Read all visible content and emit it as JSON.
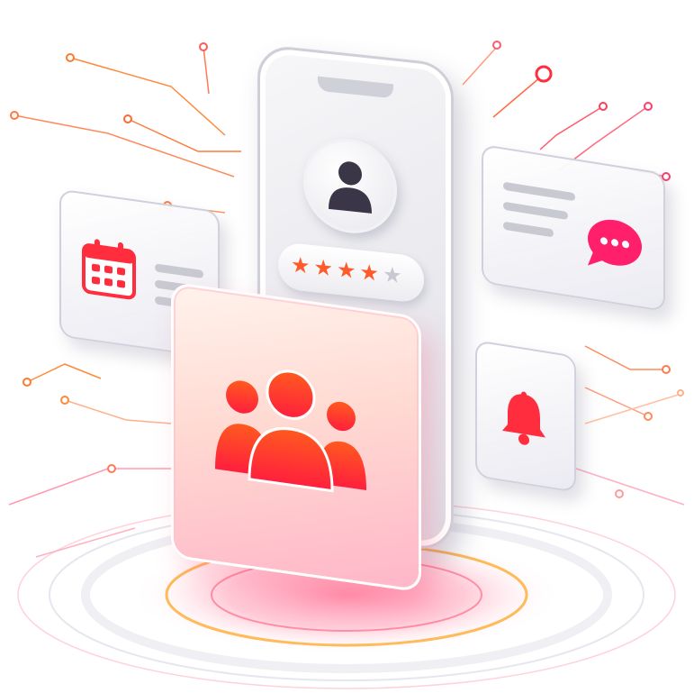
{
  "scene": {
    "description_icons": [
      "user-icon",
      "star-rating",
      "calendar-icon",
      "chat-bubble-icon",
      "bell-icon",
      "community-icon"
    ],
    "rating": {
      "filled_stars": 4,
      "total_stars": 5
    },
    "colors": {
      "accent_red": "#ff2d55",
      "accent_orange": "#ff5a1f",
      "accent_pink": "#ff3d8a",
      "glow": "#ff9a3c",
      "avatar_dark": "#3b3548",
      "text_line_gray": "#c9c9d2"
    }
  }
}
